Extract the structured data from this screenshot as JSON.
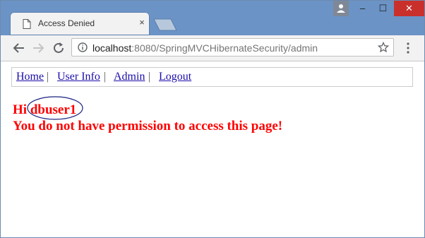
{
  "browser": {
    "tab_title": "Access Denied",
    "tab_close_glyph": "×",
    "url_host": "localhost",
    "url_path": ":8080/SpringMVCHibernateSecurity/admin",
    "window_controls": {
      "minimize": "–",
      "maximize": "☐",
      "close": "✕"
    },
    "icons": [
      "document-icon",
      "back-arrow-icon",
      "forward-arrow-icon",
      "reload-icon",
      "info-icon",
      "star-icon",
      "kebab-menu-icon",
      "user-icon"
    ]
  },
  "page": {
    "menu": [
      {
        "label": "Home"
      },
      {
        "label": "User Info"
      },
      {
        "label": "Admin"
      },
      {
        "label": "Logout"
      }
    ],
    "separator": "|",
    "greeting_prefix": "Hi ",
    "username": "dbuser1",
    "message": "You do not have permission to access this page!"
  },
  "colors": {
    "title_bar": "#6b93c5",
    "link": "#1a0dab",
    "error_text": "#ff0000",
    "annotation_ellipse": "#1a237e",
    "close_button": "#c9302c"
  }
}
